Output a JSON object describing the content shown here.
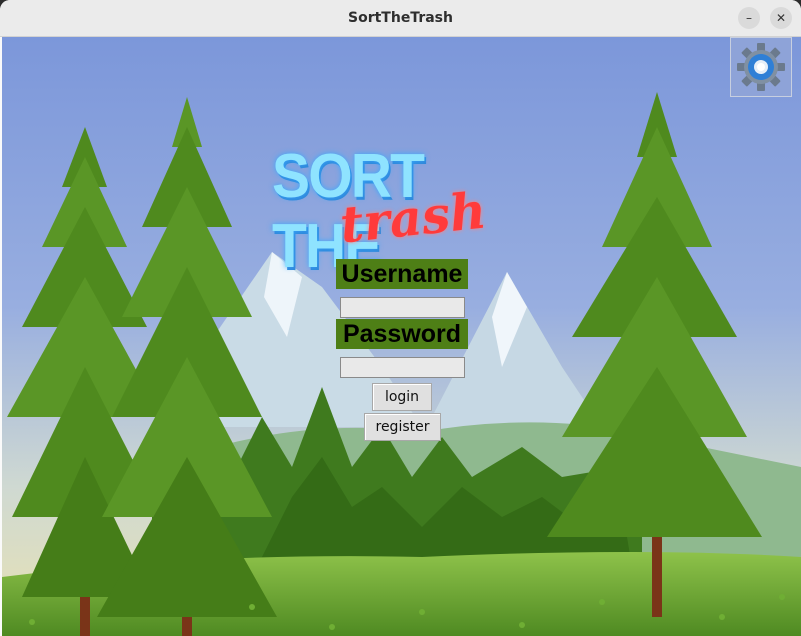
{
  "window": {
    "title": "SortTheTrash",
    "minimize_label": "–",
    "close_label": "✕"
  },
  "logo": {
    "main_text": "SORT THE",
    "script_text": "trash"
  },
  "login_form": {
    "username_label": "Username",
    "username_value": "",
    "password_label": "Password",
    "password_value": "",
    "login_button": "login",
    "register_button": "register"
  },
  "settings": {
    "icon": "gear-icon"
  },
  "colors": {
    "label_bg": "#4e7f16",
    "sky_top": "#7d97d9",
    "grass": "#5d9b2a",
    "logo_blue": "#8fe3ff",
    "logo_red": "#ff3b3b"
  }
}
